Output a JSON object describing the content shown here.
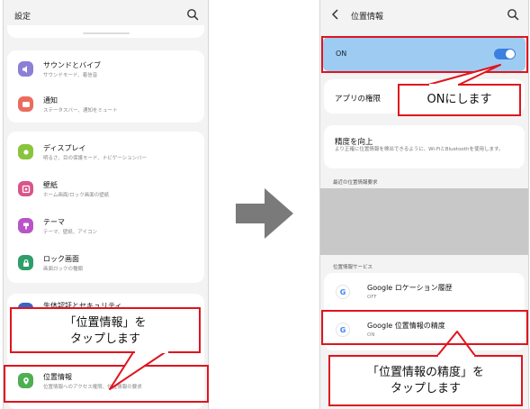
{
  "left_screen": {
    "title": "設定",
    "sections": [
      {
        "label": "サウンドとバイブ",
        "sub": "サウンドモード、着信音",
        "icon": "speaker-icon",
        "color": "#8b7fd6"
      },
      {
        "label": "通知",
        "sub": "ステータスバー、通知をミュート",
        "icon": "bell-icon",
        "color": "#ec6b5e"
      },
      {
        "label": "ディスプレイ",
        "sub": "明るさ、目の保護モード、ナビゲーションバー",
        "icon": "sun-icon",
        "color": "#8ac43f"
      },
      {
        "label": "壁紙",
        "sub": "ホーム画面/ロック画面の壁紙",
        "icon": "image-icon",
        "color": "#d8558a"
      },
      {
        "label": "テーマ",
        "sub": "テーマ、壁紙、アイコン",
        "icon": "brush-icon",
        "color": "#b954c8"
      },
      {
        "label": "ロック画面",
        "sub": "画面ロックの種類",
        "icon": "lock-icon",
        "color": "#2e9e6a"
      }
    ],
    "partial_item": "生体認証とセキュリティ",
    "location_item": {
      "label": "位置情報",
      "sub": "位置情報へのアクセス権限、位置情報の要求",
      "icon": "location-pin-icon",
      "color": "#4caf50"
    },
    "callout": {
      "line1": "「位置情報」を",
      "line2": "タップします"
    }
  },
  "right_screen": {
    "title": "位置情報",
    "toggle_label": "ON",
    "app_permissions": "アプリの権限",
    "accuracy": {
      "label": "精度を向上",
      "sub": "より正確に位置情報を検出できるように、Wi-FiとBluetoothを使用します。"
    },
    "recent_requests_header": "最近の位置情報要求",
    "services_header": "位置情報サービス",
    "services": [
      {
        "label": "Google ロケーション履歴",
        "sub": "OFF",
        "logo": "G"
      },
      {
        "label": "Google 位置情報の精度",
        "sub": "ON",
        "logo": "G"
      }
    ],
    "callout_on": "ONにします",
    "callout_accuracy": {
      "line1": "「位置情報の精度」を",
      "line2": "タップします"
    }
  },
  "colors": {
    "accent_red": "#e0141e",
    "toggle_on": "#3b7fe0",
    "on_row_bg": "#9ecbf2",
    "arrow": "#7a7a7a"
  }
}
